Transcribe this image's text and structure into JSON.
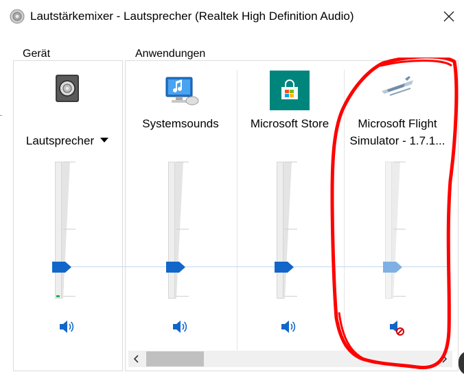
{
  "window": {
    "title": "Lautstärkemixer - Lautsprecher (Realtek High Definition Audio)"
  },
  "device_group": {
    "label": "Gerät",
    "device": {
      "name": "Lautsprecher",
      "icon": "speaker-device-icon",
      "volume_percent": 100,
      "muted": false
    }
  },
  "apps_group": {
    "label": "Anwendungen",
    "apps": [
      {
        "name": "Systemsounds",
        "icon": "system-sounds-icon",
        "volume_percent": 100,
        "muted": false
      },
      {
        "name": "Microsoft Store",
        "icon": "microsoft-store-icon",
        "volume_percent": 100,
        "muted": false
      },
      {
        "name": "Microsoft Flight\nSimulator - 1.7.1...",
        "icon": "flight-simulator-icon",
        "volume_percent": 100,
        "muted": true
      }
    ]
  },
  "colors": {
    "accent": "#1266c9",
    "annotation": "#ff0000",
    "store_tile": "#00857c",
    "meter": "#21b24b"
  }
}
